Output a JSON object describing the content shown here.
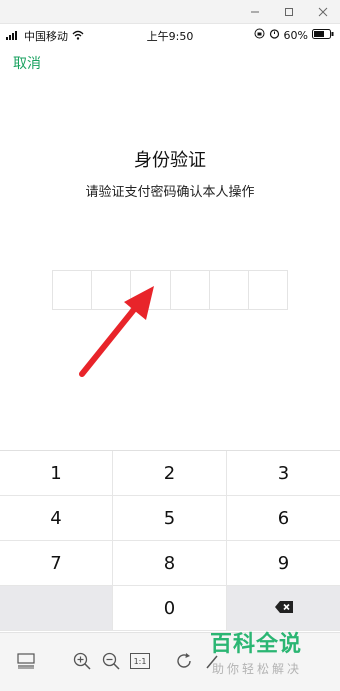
{
  "window": {
    "minimize_icon": "minimize-icon",
    "maximize_icon": "maximize-icon",
    "close_icon": "close-icon"
  },
  "status_bar": {
    "carrier": "中国移动",
    "time": "上午9:50",
    "battery": "60%",
    "icons": [
      "signal-icon",
      "wifi-icon",
      "lock-rotation-icon",
      "alarm-icon",
      "battery-icon"
    ]
  },
  "header": {
    "cancel_label": "取消"
  },
  "auth": {
    "title": "身份验证",
    "subtitle": "请验证支付密码确认本人操作",
    "pin_length": 6
  },
  "annotation": {
    "arrow_color": "#e8242a"
  },
  "keypad": {
    "keys": [
      "1",
      "2",
      "3",
      "4",
      "5",
      "6",
      "7",
      "8",
      "9",
      "",
      "0",
      "⌫"
    ],
    "delete_icon": "backspace-icon"
  },
  "toolbar": {
    "icons": [
      "layout-icon",
      "zoom-in-icon",
      "zoom-out-icon",
      "actual-size-icon",
      "rotate-icon",
      "edit-icon"
    ],
    "actual_size_label": "1:1"
  },
  "watermark": {
    "title": "百科全说",
    "subtitle": "助你轻松解决"
  },
  "colors": {
    "accent": "#1aa260",
    "watermark": "#2bb673",
    "keypad_gray": "#e9e9ec"
  }
}
